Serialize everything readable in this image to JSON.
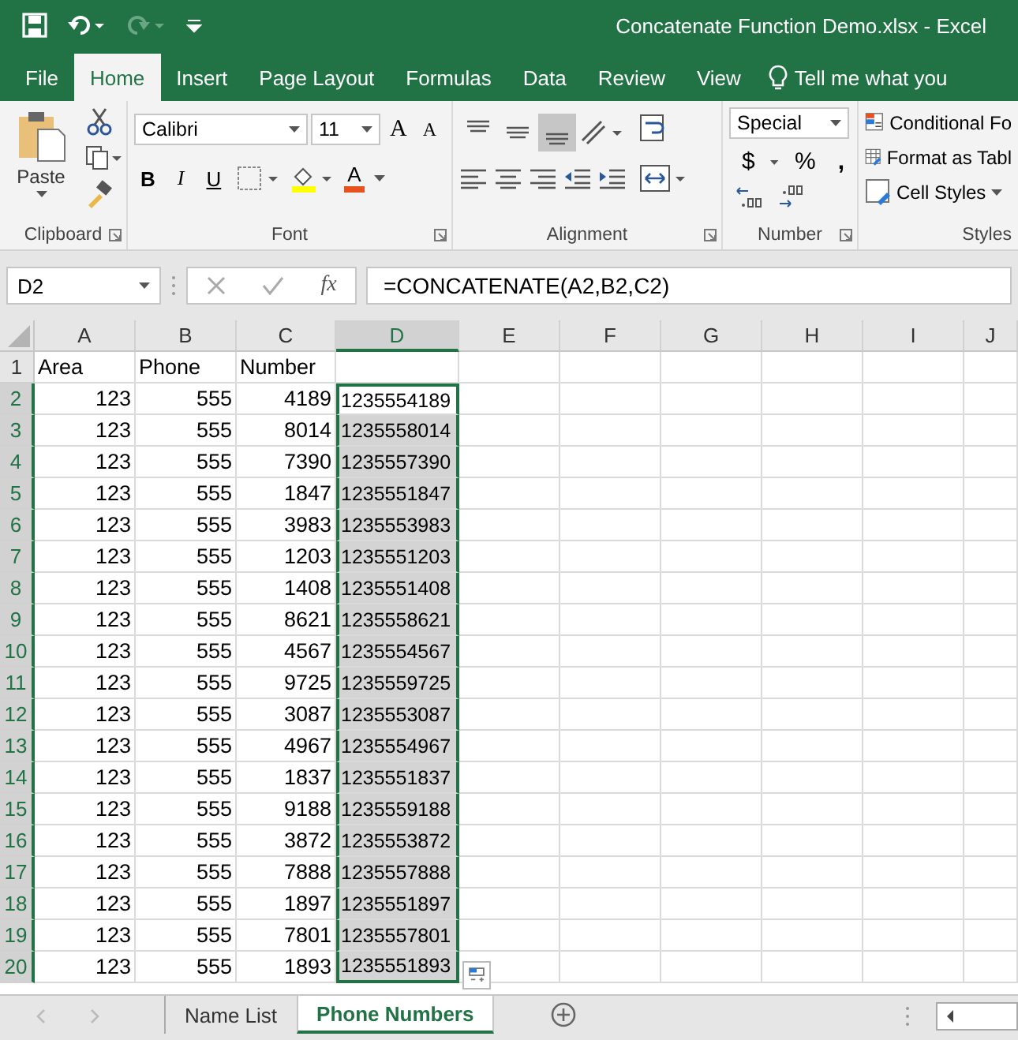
{
  "title_bar": {
    "title": "Concatenate Function Demo.xlsx - Excel"
  },
  "ribbon_tabs": [
    {
      "label": "File",
      "selected": false
    },
    {
      "label": "Home",
      "selected": true
    },
    {
      "label": "Insert",
      "selected": false
    },
    {
      "label": "Page Layout",
      "selected": false
    },
    {
      "label": "Formulas",
      "selected": false
    },
    {
      "label": "Data",
      "selected": false
    },
    {
      "label": "Review",
      "selected": false
    },
    {
      "label": "View",
      "selected": false
    }
  ],
  "tell_me": "Tell me what you",
  "ribbon": {
    "paste_label": "Paste",
    "font_name": "Calibri",
    "font_size": "11",
    "grow_shrink": [
      "A",
      "A"
    ],
    "format_buttons": [
      "B",
      "I",
      "U"
    ],
    "font_color_letter": "A",
    "vertical_align": [
      {
        "kind": "top",
        "selected": false
      },
      {
        "kind": "middle",
        "selected": false
      },
      {
        "kind": "bottom",
        "selected": true
      }
    ],
    "number_format": "Special",
    "number_buttons": [
      "$",
      "%",
      ","
    ],
    "styles": [
      "Conditional Fo",
      "Format as Tabl",
      "Cell Styles"
    ],
    "groups": [
      "Clipboard",
      "Font",
      "Alignment",
      "Number",
      "Styles"
    ]
  },
  "formula_bar": {
    "name_box": "D2",
    "fx": "fx",
    "formula": "=CONCATENATE(A2,B2,C2)"
  },
  "columns": [
    {
      "label": "A",
      "selected": false
    },
    {
      "label": "B",
      "selected": false
    },
    {
      "label": "C",
      "selected": false
    },
    {
      "label": "D",
      "selected": true
    },
    {
      "label": "E",
      "selected": false
    },
    {
      "label": "F",
      "selected": false
    },
    {
      "label": "G",
      "selected": false
    },
    {
      "label": "H",
      "selected": false
    },
    {
      "label": "I",
      "selected": false
    },
    {
      "label": "J",
      "selected": false
    }
  ],
  "rows": [
    {
      "number": "1",
      "selected": false,
      "cells": [
        "Area",
        "Phone",
        "Number",
        ""
      ]
    },
    {
      "number": "2",
      "selected": true,
      "cells": [
        "123",
        "555",
        "4189",
        "1235554189"
      ]
    },
    {
      "number": "3",
      "selected": true,
      "cells": [
        "123",
        "555",
        "8014",
        "1235558014"
      ]
    },
    {
      "number": "4",
      "selected": true,
      "cells": [
        "123",
        "555",
        "7390",
        "1235557390"
      ]
    },
    {
      "number": "5",
      "selected": true,
      "cells": [
        "123",
        "555",
        "1847",
        "1235551847"
      ]
    },
    {
      "number": "6",
      "selected": true,
      "cells": [
        "123",
        "555",
        "3983",
        "1235553983"
      ]
    },
    {
      "number": "7",
      "selected": true,
      "cells": [
        "123",
        "555",
        "1203",
        "1235551203"
      ]
    },
    {
      "number": "8",
      "selected": true,
      "cells": [
        "123",
        "555",
        "1408",
        "1235551408"
      ]
    },
    {
      "number": "9",
      "selected": true,
      "cells": [
        "123",
        "555",
        "8621",
        "1235558621"
      ]
    },
    {
      "number": "10",
      "selected": true,
      "cells": [
        "123",
        "555",
        "4567",
        "1235554567"
      ]
    },
    {
      "number": "11",
      "selected": true,
      "cells": [
        "123",
        "555",
        "9725",
        "1235559725"
      ]
    },
    {
      "number": "12",
      "selected": true,
      "cells": [
        "123",
        "555",
        "3087",
        "1235553087"
      ]
    },
    {
      "number": "13",
      "selected": true,
      "cells": [
        "123",
        "555",
        "4967",
        "1235554967"
      ]
    },
    {
      "number": "14",
      "selected": true,
      "cells": [
        "123",
        "555",
        "1837",
        "1235551837"
      ]
    },
    {
      "number": "15",
      "selected": true,
      "cells": [
        "123",
        "555",
        "9188",
        "1235559188"
      ]
    },
    {
      "number": "16",
      "selected": true,
      "cells": [
        "123",
        "555",
        "3872",
        "1235553872"
      ]
    },
    {
      "number": "17",
      "selected": true,
      "cells": [
        "123",
        "555",
        "7888",
        "1235557888"
      ]
    },
    {
      "number": "18",
      "selected": true,
      "cells": [
        "123",
        "555",
        "1897",
        "1235551897"
      ]
    },
    {
      "number": "19",
      "selected": true,
      "cells": [
        "123",
        "555",
        "7801",
        "1235557801"
      ]
    },
    {
      "number": "20",
      "selected": true,
      "cells": [
        "123",
        "555",
        "1893",
        "1235551893"
      ]
    }
  ],
  "sheet_tabs": [
    {
      "label": "Name List",
      "selected": false
    },
    {
      "label": "Phone Numbers",
      "selected": true
    }
  ]
}
